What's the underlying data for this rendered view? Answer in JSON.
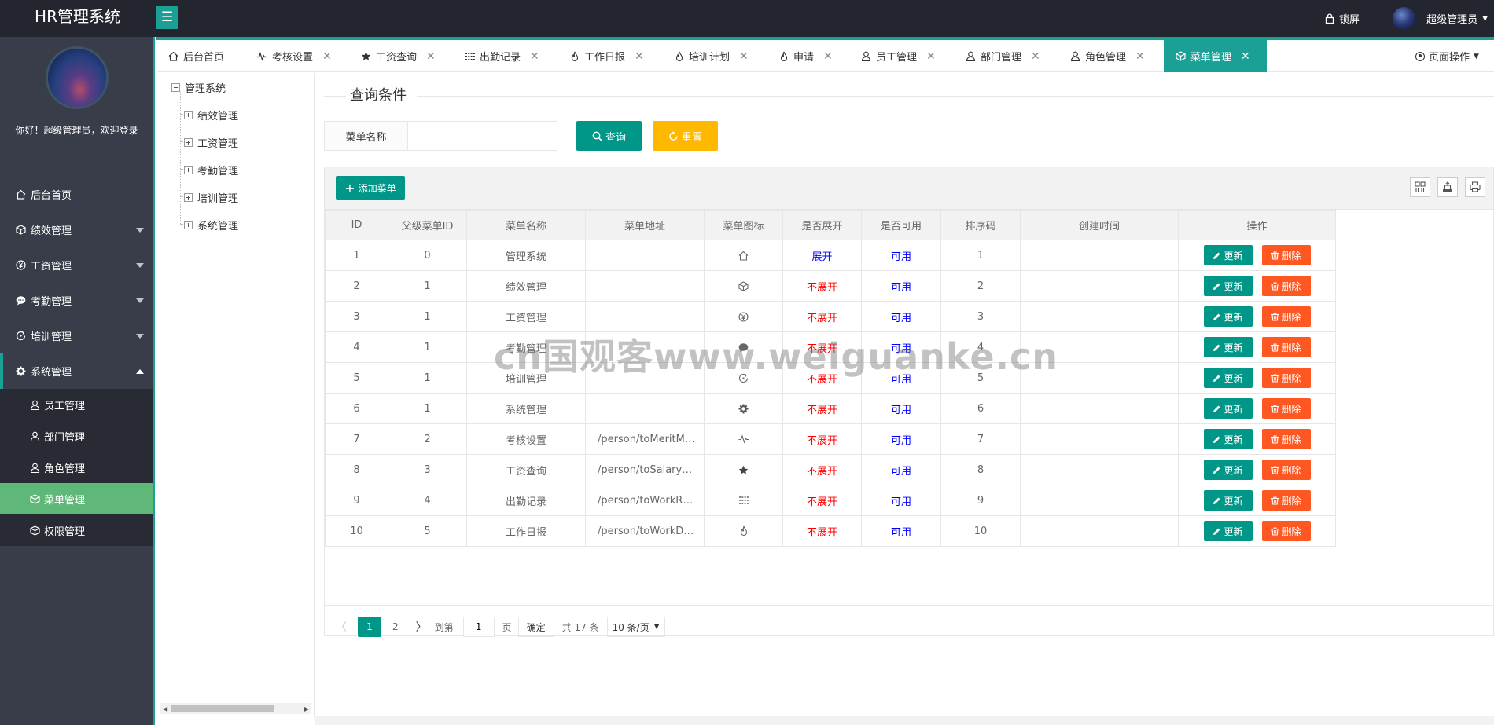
{
  "header": {
    "logo": "HR管理系统",
    "lock_label": "锁屏",
    "user_name": "超级管理员"
  },
  "sidebar": {
    "welcome": "你好！超级管理员，欢迎登录",
    "items": [
      {
        "label": "后台首页",
        "icon": "home-icon"
      },
      {
        "label": "绩效管理",
        "icon": "cube-icon"
      },
      {
        "label": "工资管理",
        "icon": "yen-icon"
      },
      {
        "label": "考勤管理",
        "icon": "chat-icon"
      },
      {
        "label": "培训管理",
        "icon": "refresh-icon"
      },
      {
        "label": "系统管理",
        "icon": "gear-icon"
      }
    ],
    "sub_items": [
      {
        "label": "员工管理",
        "icon": "user-icon"
      },
      {
        "label": "部门管理",
        "icon": "user-icon"
      },
      {
        "label": "角色管理",
        "icon": "user-icon"
      },
      {
        "label": "菜单管理",
        "icon": "cube-icon"
      },
      {
        "label": "权限管理",
        "icon": "cube-icon"
      }
    ]
  },
  "tabs": [
    {
      "label": "后台首页",
      "icon": "home-icon",
      "closable": false
    },
    {
      "label": "考核设置",
      "icon": "pulse-icon",
      "closable": true
    },
    {
      "label": "工资查询",
      "icon": "star-icon",
      "closable": true
    },
    {
      "label": "出勤记录",
      "icon": "grid-icon",
      "closable": true
    },
    {
      "label": "工作日报",
      "icon": "fire-icon",
      "closable": true
    },
    {
      "label": "培训计划",
      "icon": "fire-icon",
      "closable": true
    },
    {
      "label": "申请",
      "icon": "fire-icon",
      "closable": true
    },
    {
      "label": "员工管理",
      "icon": "user-icon",
      "closable": true
    },
    {
      "label": "部门管理",
      "icon": "user-icon",
      "closable": true
    },
    {
      "label": "角色管理",
      "icon": "user-icon",
      "closable": true
    },
    {
      "label": "菜单管理",
      "icon": "cube-icon",
      "closable": true,
      "active": true
    }
  ],
  "page_ops_label": "页面操作",
  "tree": {
    "root": "管理系统",
    "children": [
      "绩效管理",
      "工资管理",
      "考勤管理",
      "培训管理",
      "系统管理"
    ]
  },
  "query": {
    "title": "查询条件",
    "field_label": "菜单名称",
    "field_value": "",
    "search_label": "查询",
    "reset_label": "重置"
  },
  "toolbar": {
    "add_label": "添加菜单"
  },
  "table": {
    "columns": [
      "ID",
      "父级菜单ID",
      "菜单名称",
      "菜单地址",
      "菜单图标",
      "是否展开",
      "是否可用",
      "排序码",
      "创建时间",
      "操作"
    ],
    "update_label": "更新",
    "delete_label": "删除",
    "rows": [
      {
        "id": "1",
        "parent": "0",
        "name": "管理系统",
        "url": "",
        "icon": "home-icon",
        "expand": "展开",
        "enabled": "可用",
        "sort": "1",
        "created": ""
      },
      {
        "id": "2",
        "parent": "1",
        "name": "绩效管理",
        "url": "",
        "icon": "cube-icon",
        "expand": "不展开",
        "enabled": "可用",
        "sort": "2",
        "created": ""
      },
      {
        "id": "3",
        "parent": "1",
        "name": "工资管理",
        "url": "",
        "icon": "yen-icon",
        "expand": "不展开",
        "enabled": "可用",
        "sort": "3",
        "created": ""
      },
      {
        "id": "4",
        "parent": "1",
        "name": "考勤管理",
        "url": "",
        "icon": "chat-icon",
        "expand": "不展开",
        "enabled": "可用",
        "sort": "4",
        "created": ""
      },
      {
        "id": "5",
        "parent": "1",
        "name": "培训管理",
        "url": "",
        "icon": "refresh-icon",
        "expand": "不展开",
        "enabled": "可用",
        "sort": "5",
        "created": ""
      },
      {
        "id": "6",
        "parent": "1",
        "name": "系统管理",
        "url": "",
        "icon": "gear-icon",
        "expand": "不展开",
        "enabled": "可用",
        "sort": "6",
        "created": ""
      },
      {
        "id": "7",
        "parent": "2",
        "name": "考核设置",
        "url": "/person/toMeritM…",
        "icon": "pulse-icon",
        "expand": "不展开",
        "enabled": "可用",
        "sort": "7",
        "created": ""
      },
      {
        "id": "8",
        "parent": "3",
        "name": "工资查询",
        "url": "/person/toSalary…",
        "icon": "star-icon",
        "expand": "不展开",
        "enabled": "可用",
        "sort": "8",
        "created": ""
      },
      {
        "id": "9",
        "parent": "4",
        "name": "出勤记录",
        "url": "/person/toWorkR…",
        "icon": "grid-icon",
        "expand": "不展开",
        "enabled": "可用",
        "sort": "9",
        "created": ""
      },
      {
        "id": "10",
        "parent": "5",
        "name": "工作日报",
        "url": "/person/toWorkD…",
        "icon": "fire-icon",
        "expand": "不展开",
        "enabled": "可用",
        "sort": "10",
        "created": ""
      }
    ]
  },
  "pager": {
    "current": "1",
    "page2": "2",
    "goto_label": "到第",
    "goto_value": "1",
    "page_unit": "页",
    "ok_label": "确定",
    "total_label": "共 17 条",
    "page_size": "10 条/页"
  },
  "watermark": "cn国观客www.weiguanke.cn",
  "colors": {
    "accent": "#1aa094",
    "primary": "#009688",
    "warn": "#ffb800",
    "danger": "#ff5722",
    "active_sub": "#5fb878",
    "header_bg": "#23262e",
    "sidebar_bg": "#393d49"
  }
}
